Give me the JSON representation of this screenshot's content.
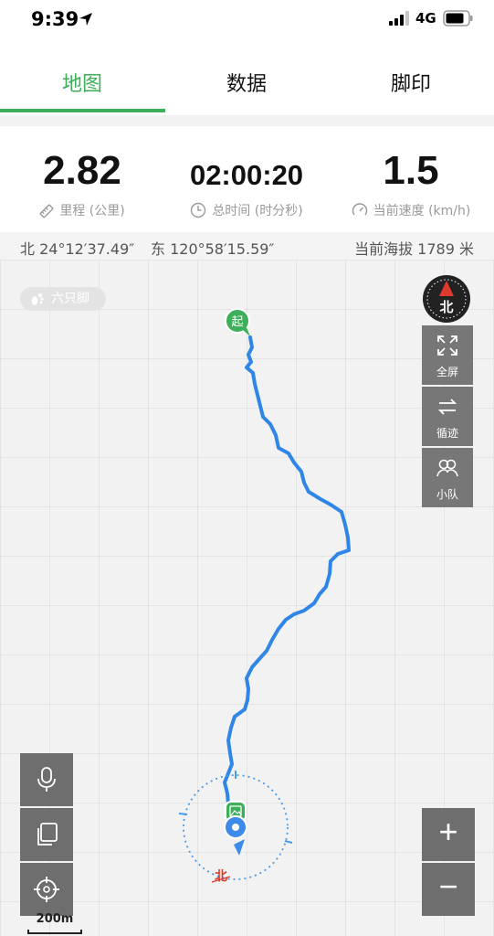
{
  "status_bar": {
    "time": "9:39",
    "network": "4G",
    "icons": [
      "location-arrow-icon",
      "signal-icon",
      "battery-icon"
    ]
  },
  "tabs": [
    {
      "label": "地图",
      "active": true
    },
    {
      "label": "数据",
      "active": false
    },
    {
      "label": "脚印",
      "active": false
    }
  ],
  "stats": {
    "distance": {
      "value": "2.82",
      "label": "里程 (公里)",
      "icon": "ruler-icon"
    },
    "time": {
      "value": "02:00:20",
      "label": "总时间 (时分秒)",
      "icon": "clock-icon"
    },
    "speed": {
      "value": "1.5",
      "label": "当前速度 (km/h)",
      "icon": "speedometer-icon"
    }
  },
  "coords": {
    "latitude": "北 24°12′37.49″",
    "longitude": "东 120°58′15.59″",
    "altitude": "当前海拔 1789 米"
  },
  "map": {
    "watermark": "六只脚",
    "start_marker": "起",
    "direction_marker": "北",
    "compass_label": "北",
    "buttons": {
      "fullscreen": "全屏",
      "retrace": "循迹",
      "team": "小队"
    },
    "tools": [
      "microphone-icon",
      "copy-icon",
      "locate-icon"
    ],
    "zoom_in": "+",
    "zoom_out": "−",
    "scale": "200m"
  },
  "colors": {
    "accent": "#3dae5a",
    "track": "#2f86e6",
    "compass_needle": "#e03a2f"
  }
}
